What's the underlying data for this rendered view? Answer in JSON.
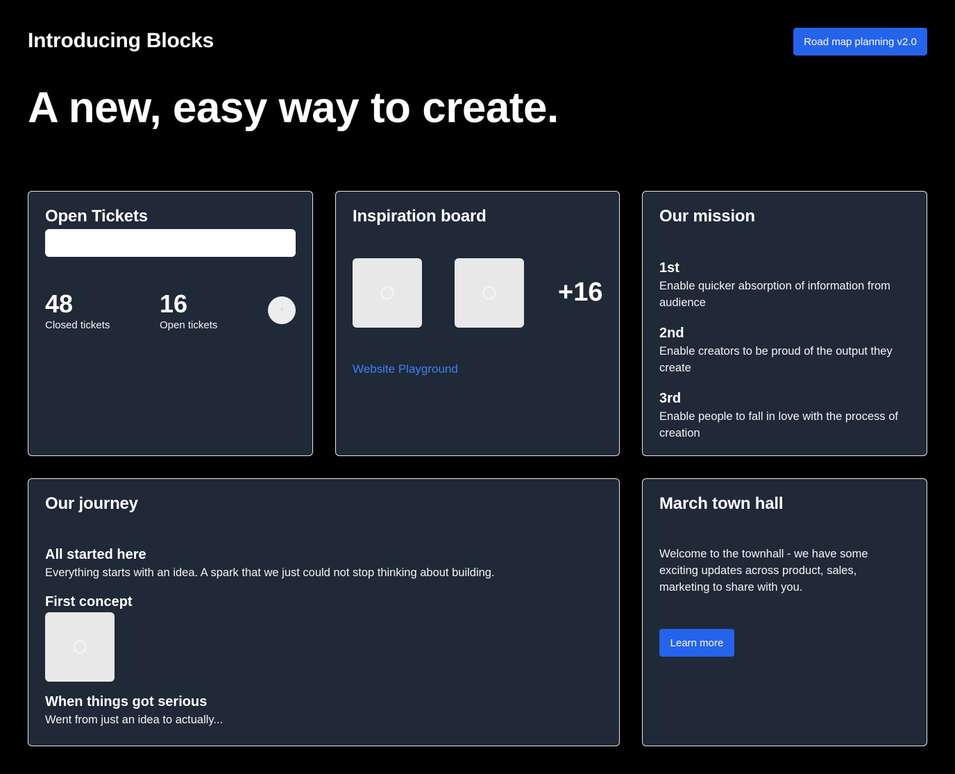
{
  "header": {
    "brand": "Introducing Blocks",
    "cta_label": "Road map planning v2.0",
    "headline": "A new, easy way to create."
  },
  "tickets_card": {
    "title": "Open Tickets",
    "input_value": "",
    "stats": [
      {
        "value": "48",
        "label": "Closed tickets"
      },
      {
        "value": "16",
        "label": "Open tickets"
      }
    ]
  },
  "inspiration_card": {
    "title": "Inspiration board",
    "more_count": "+16",
    "link_label": "Website Playground"
  },
  "mission_card": {
    "title": "Our mission",
    "items": [
      {
        "rank": "1st",
        "text": "Enable quicker absorption of information from audience"
      },
      {
        "rank": "2nd",
        "text": "Enable creators to be proud of the output they create"
      },
      {
        "rank": "3rd",
        "text": "Enable people to fall in love with the process of creation"
      }
    ]
  },
  "journey_card": {
    "title": "Our journey",
    "items": [
      {
        "heading": "All started here",
        "text": "Everything starts with an idea. A spark that we just could not stop thinking about building."
      },
      {
        "heading": "First concept"
      },
      {
        "heading": "When things got serious",
        "text": "Went from just an idea to actually..."
      }
    ]
  },
  "townhall_card": {
    "title": "March town hall",
    "text": "Welcome to the townhall - we have some exciting updates across product, sales, marketing to share with you.",
    "button_label": "Learn more"
  },
  "colors": {
    "page_bg": "#000000",
    "card_bg": "#1f2937",
    "accent": "#2563eb",
    "link": "#3b82f6"
  }
}
